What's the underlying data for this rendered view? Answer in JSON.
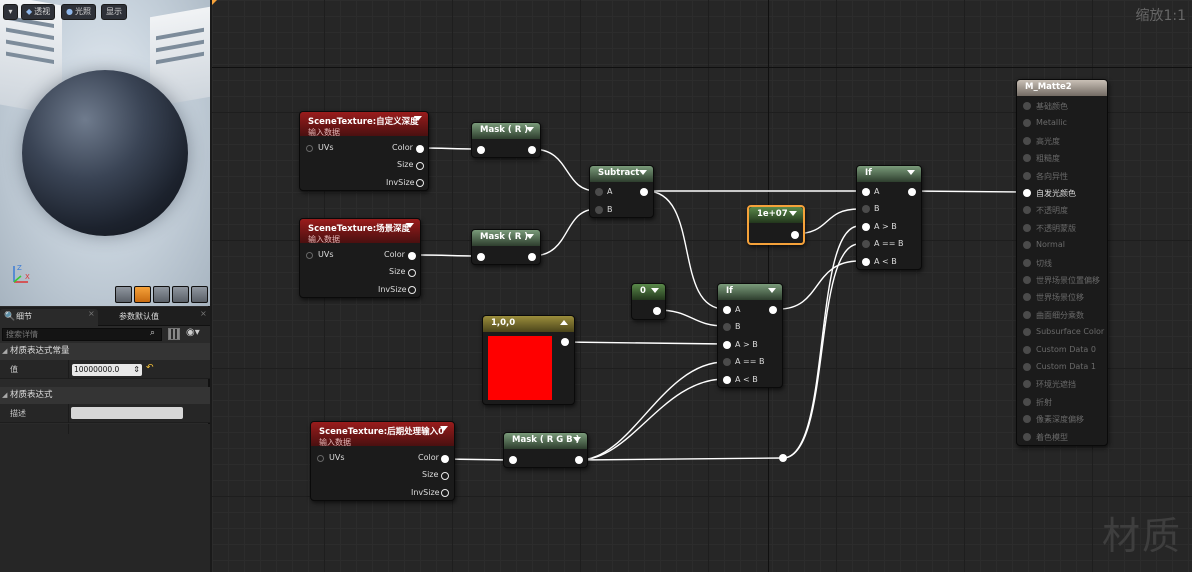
{
  "viewport": {
    "buttons": {
      "perspective": "透视",
      "lit": "光照",
      "show": "显示"
    },
    "axis": {
      "z": "Z",
      "x": "X"
    }
  },
  "tabs": {
    "details": "细节",
    "param_defaults": "参数默认值"
  },
  "search": {
    "placeholder": "搜索详情"
  },
  "details": {
    "section_constant": "材质表达式常量",
    "value_label": "值",
    "value": "10000000.0",
    "section_expression": "材质表达式",
    "desc_label": "描述"
  },
  "graph": {
    "zoom": "缩放1:1",
    "watermark": "材质",
    "nodes": {
      "st1": {
        "title": "SceneTexture:自定义深度",
        "sub": "输入数据",
        "uvs": "UVs",
        "color": "Color",
        "size": "Size",
        "invsize": "InvSize"
      },
      "st2": {
        "title": "SceneTexture:场景深度",
        "sub": "输入数据",
        "uvs": "UVs",
        "color": "Color",
        "size": "Size",
        "invsize": "InvSize"
      },
      "st3": {
        "title": "SceneTexture:后期处理输入0",
        "sub": "输入数据",
        "uvs": "UVs",
        "color": "Color",
        "size": "Size",
        "invsize": "InvSize"
      },
      "mask1": {
        "title": "Mask ( R )"
      },
      "mask2": {
        "title": "Mask ( R )"
      },
      "mask3": {
        "title": "Mask ( R G B )"
      },
      "subtract": {
        "title": "Subtract",
        "a": "A",
        "b": "B"
      },
      "const_big": {
        "title": "1e+07"
      },
      "const_zero": {
        "title": "0"
      },
      "vec_color": {
        "title": "1,0,0"
      },
      "if1": {
        "title": "If",
        "a": "A",
        "b": "B",
        "agb": "A > B",
        "aeb": "A == B",
        "alb": "A < B"
      },
      "if2": {
        "title": "If",
        "a": "A",
        "b": "B",
        "agb": "A > B",
        "aeb": "A == B",
        "alb": "A < B"
      },
      "material": {
        "title": "M_Matte2",
        "inputs": [
          "基础颜色",
          "Metallic",
          "高光度",
          "粗糙度",
          "各向异性",
          "自发光颜色",
          "不透明度",
          "不透明蒙版",
          "Normal",
          "切线",
          "世界场景位置偏移",
          "世界场景位移",
          "曲面细分乘数",
          "Subsurface Color",
          "Custom Data 0",
          "Custom Data 1",
          "环境光遮挡",
          "折射",
          "像素深度偏移",
          "着色模型"
        ],
        "active_index": 5
      }
    }
  },
  "colors": {
    "accent": "#f6a23a",
    "red_header": "#9a1c1c",
    "constant_color": "#ff0000"
  }
}
